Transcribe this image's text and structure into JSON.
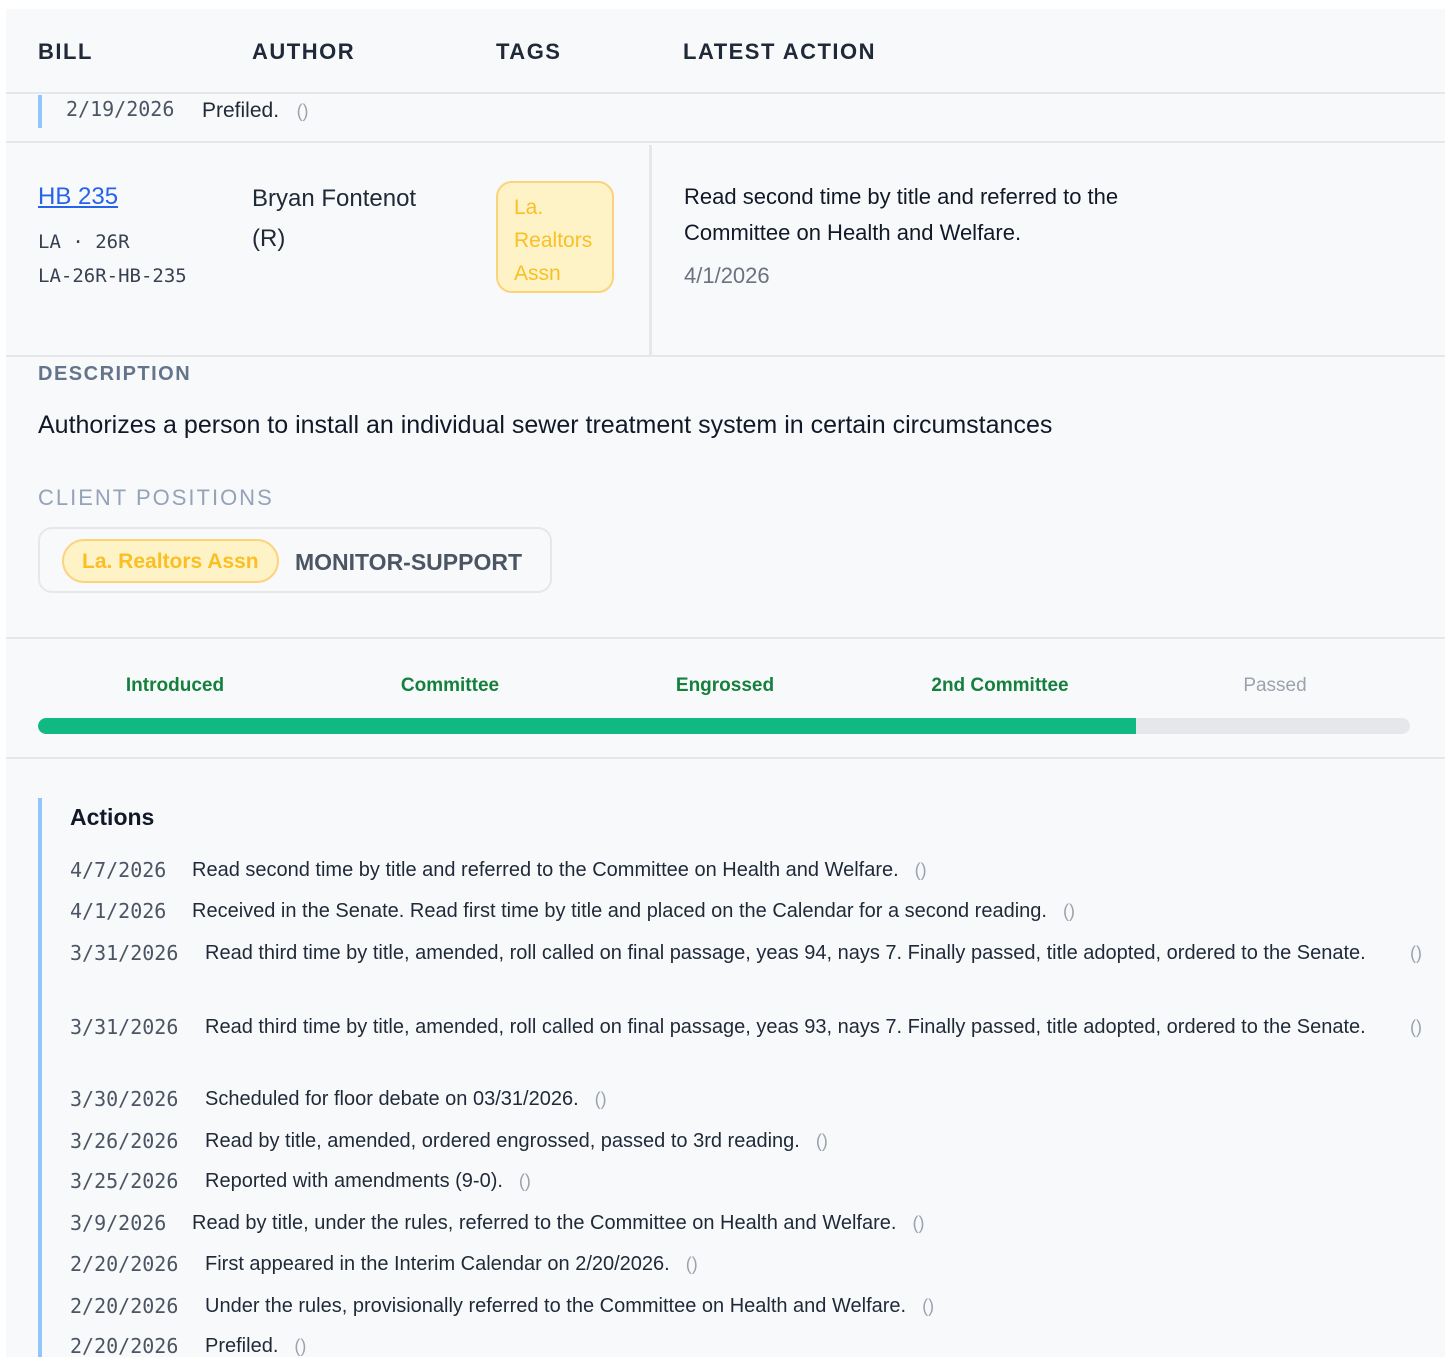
{
  "table": {
    "headers": {
      "bill": "BILL",
      "author": "AUTHOR",
      "tags": "TAGS",
      "latest_action": "LATEST ACTION"
    }
  },
  "previous_row": {
    "date": "2/19/2026",
    "text": "Prefiled.",
    "paren": "()"
  },
  "bill": {
    "number": "HB 235",
    "state_session": "LA · 26R",
    "id": "LA-26R-HB-235",
    "author": "Bryan Fontenot (R)",
    "tag": "La. Realtors Assn",
    "latest_action": "Read second time by title and referred to the Committee on Health and Welfare.",
    "latest_action_date": "4/1/2026"
  },
  "description": {
    "label": "DESCRIPTION",
    "text": "Authorizes a person to install an individual sewer treatment system in certain circumstances"
  },
  "client_positions": {
    "label": "CLIENT POSITIONS",
    "client": "La. Realtors Assn",
    "position": "MONITOR-SUPPORT"
  },
  "progress": {
    "stages": [
      {
        "label": "Introduced",
        "done": true
      },
      {
        "label": "Committee",
        "done": true
      },
      {
        "label": "Engrossed",
        "done": true
      },
      {
        "label": "2nd Committee",
        "done": true
      },
      {
        "label": "Passed",
        "done": false
      }
    ],
    "fraction_complete": 0.8,
    "colors": {
      "done": "#10b981",
      "track": "#e5e7eb"
    }
  },
  "actions": {
    "title": "Actions",
    "items": [
      {
        "date": "4/7/2026",
        "text": "Read second time by title and referred to the Committee on Health and Welfare.",
        "paren": "()"
      },
      {
        "date": "4/1/2026",
        "text": "Received in the Senate. Read first time by title and placed on the Calendar for a second reading.",
        "paren": "()"
      },
      {
        "date": "3/31/2026",
        "text": "Read third time by title, amended, roll called on final passage, yeas 94, nays 7. Finally passed, title adopted, ordered to the Senate.",
        "paren": "()"
      },
      {
        "date": "3/31/2026",
        "text": "Read third time by title, amended, roll called on final passage, yeas 93, nays 7. Finally passed, title adopted, ordered to the Senate.",
        "paren": "()"
      },
      {
        "date": "3/30/2026",
        "text": "Scheduled for floor debate on 03/31/2026.",
        "paren": "()"
      },
      {
        "date": "3/26/2026",
        "text": "Read by title, amended, ordered engrossed, passed to 3rd reading.",
        "paren": "()"
      },
      {
        "date": "3/25/2026",
        "text": "Reported with amendments (9-0).",
        "paren": "()"
      },
      {
        "date": "3/9/2026",
        "text": "Read by title, under the rules, referred to the Committee on Health and Welfare.",
        "paren": "()"
      },
      {
        "date": "2/20/2026",
        "text": "First appeared in the Interim Calendar on 2/20/2026.",
        "paren": "()"
      },
      {
        "date": "2/20/2026",
        "text": "Under the rules, provisionally referred to the Committee on Health and Welfare.",
        "paren": "()"
      },
      {
        "date": "2/20/2026",
        "text": "Prefiled.",
        "paren": "()"
      }
    ]
  }
}
